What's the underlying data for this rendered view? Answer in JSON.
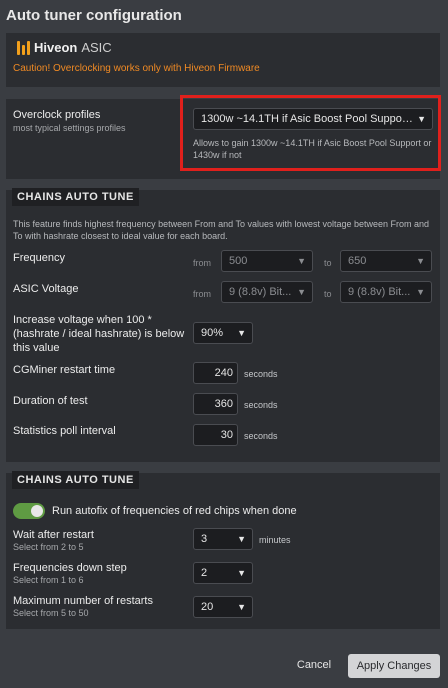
{
  "window": {
    "title": "Auto tuner configuration"
  },
  "brand": {
    "name": "Hiveon",
    "product": "ASIC",
    "caution": "Caution! Overclocking works only with Hiveon Firmware"
  },
  "overclock": {
    "label": "Overclock profiles",
    "sublabel": "most typical settings profiles",
    "selected": "1300w ~14.1TH if Asic Boost Pool Suppor...",
    "description": "Allows to gain 1300w ~14.1TH if Asic Boost Pool Support or 1430w if not"
  },
  "chains": {
    "heading": "CHAINS AUTO TUNE",
    "description": "This feature finds highest frequency between From and To values with lowest voltage between From and To with hashrate closest to ideal value for each board.",
    "frequency": {
      "label": "Frequency",
      "from_label": "from",
      "to_label": "to",
      "from_value": "500",
      "to_value": "650"
    },
    "voltage": {
      "label": "ASIC Voltage",
      "from_label": "from",
      "to_label": "to",
      "from_value": "9 (8.8v) Bit...",
      "to_value": "9 (8.8v) Bit..."
    },
    "increase_voltage": {
      "label": "Increase voltage when 100 * (hashrate / ideal hashrate) is below this value",
      "value": "90%"
    },
    "restart_time": {
      "label": "CGMiner restart time",
      "value": "240",
      "unit": "seconds"
    },
    "test_duration": {
      "label": "Duration of test",
      "value": "360",
      "unit": "seconds"
    },
    "poll_interval": {
      "label": "Statistics poll interval",
      "value": "30",
      "unit": "seconds"
    }
  },
  "chains2": {
    "heading": "CHAINS AUTO TUNE",
    "autofix": {
      "label": "Run autofix of frequencies of red chips when done",
      "on": true
    },
    "wait_after_restart": {
      "label": "Wait after restart",
      "sublabel": "Select from 2 to 5",
      "value": "3",
      "unit": "minutes"
    },
    "freq_down_step": {
      "label": "Frequencies down step",
      "sublabel": "Select from 1 to 6",
      "value": "2"
    },
    "max_restarts": {
      "label": "Maximum number of restarts",
      "sublabel": "Select from 5 to 50",
      "value": "20"
    }
  },
  "footer": {
    "cancel": "Cancel",
    "apply": "Apply Changes"
  },
  "colors": {
    "accent_orange": "#f08a24",
    "toggle_green": "#5f9b43",
    "highlight_red": "#e0201c"
  }
}
